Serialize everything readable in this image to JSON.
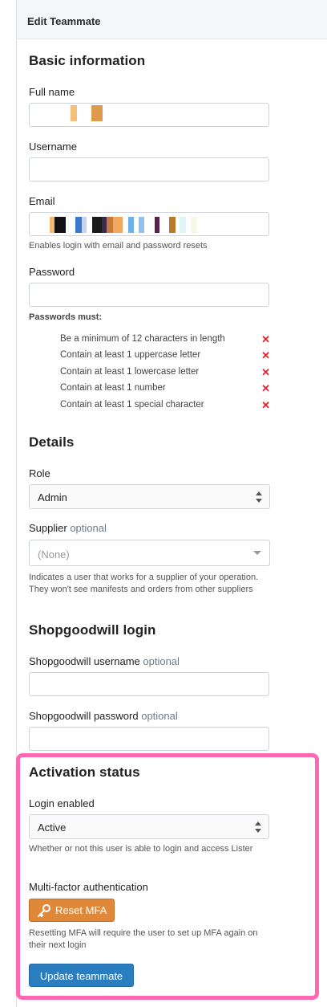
{
  "header": {
    "title": "Edit Teammate"
  },
  "basic": {
    "heading": "Basic information",
    "full_name": {
      "label": "Full name",
      "value": ""
    },
    "username": {
      "label": "Username",
      "value": ""
    },
    "email": {
      "label": "Email",
      "value": "",
      "help": "Enables login with email and password resets"
    },
    "password": {
      "label": "Password",
      "value": ""
    },
    "rules_title": "Passwords must:",
    "rules": [
      "Be a minimum of 12 characters in length",
      "Contain at least 1 uppercase letter",
      "Contain at least 1 lowercase letter",
      "Contain at least 1 number",
      "Contain at least 1 special character"
    ],
    "rule_fail_mark": "✕"
  },
  "details": {
    "heading": "Details",
    "role": {
      "label": "Role",
      "value": "Admin"
    },
    "supplier": {
      "label": "Supplier",
      "optional": "optional",
      "placeholder": "(None)",
      "help": "Indicates a user that works for a supplier of your operation. They won't see manifests and orders from other suppliers"
    }
  },
  "shopgoodwill": {
    "heading": "Shopgoodwill login",
    "username": {
      "label": "Shopgoodwill username",
      "optional": "optional",
      "value": ""
    },
    "password": {
      "label": "Shopgoodwill password",
      "optional": "optional",
      "value": ""
    }
  },
  "activation": {
    "heading": "Activation status",
    "login_enabled": {
      "label": "Login enabled",
      "value": "Active",
      "help": "Whether or not this user is able to login and access Lister"
    },
    "mfa": {
      "label": "Multi-factor authentication",
      "button": "Reset MFA",
      "help": "Resetting MFA will require the user to set up MFA again on their next login"
    }
  },
  "submit": {
    "label": "Update teammate"
  },
  "colors": {
    "highlight": "#ff69b4",
    "mfa_button": "#e0883a",
    "primary_button": "#2a7ec0",
    "fail_mark": "#e0242b"
  }
}
